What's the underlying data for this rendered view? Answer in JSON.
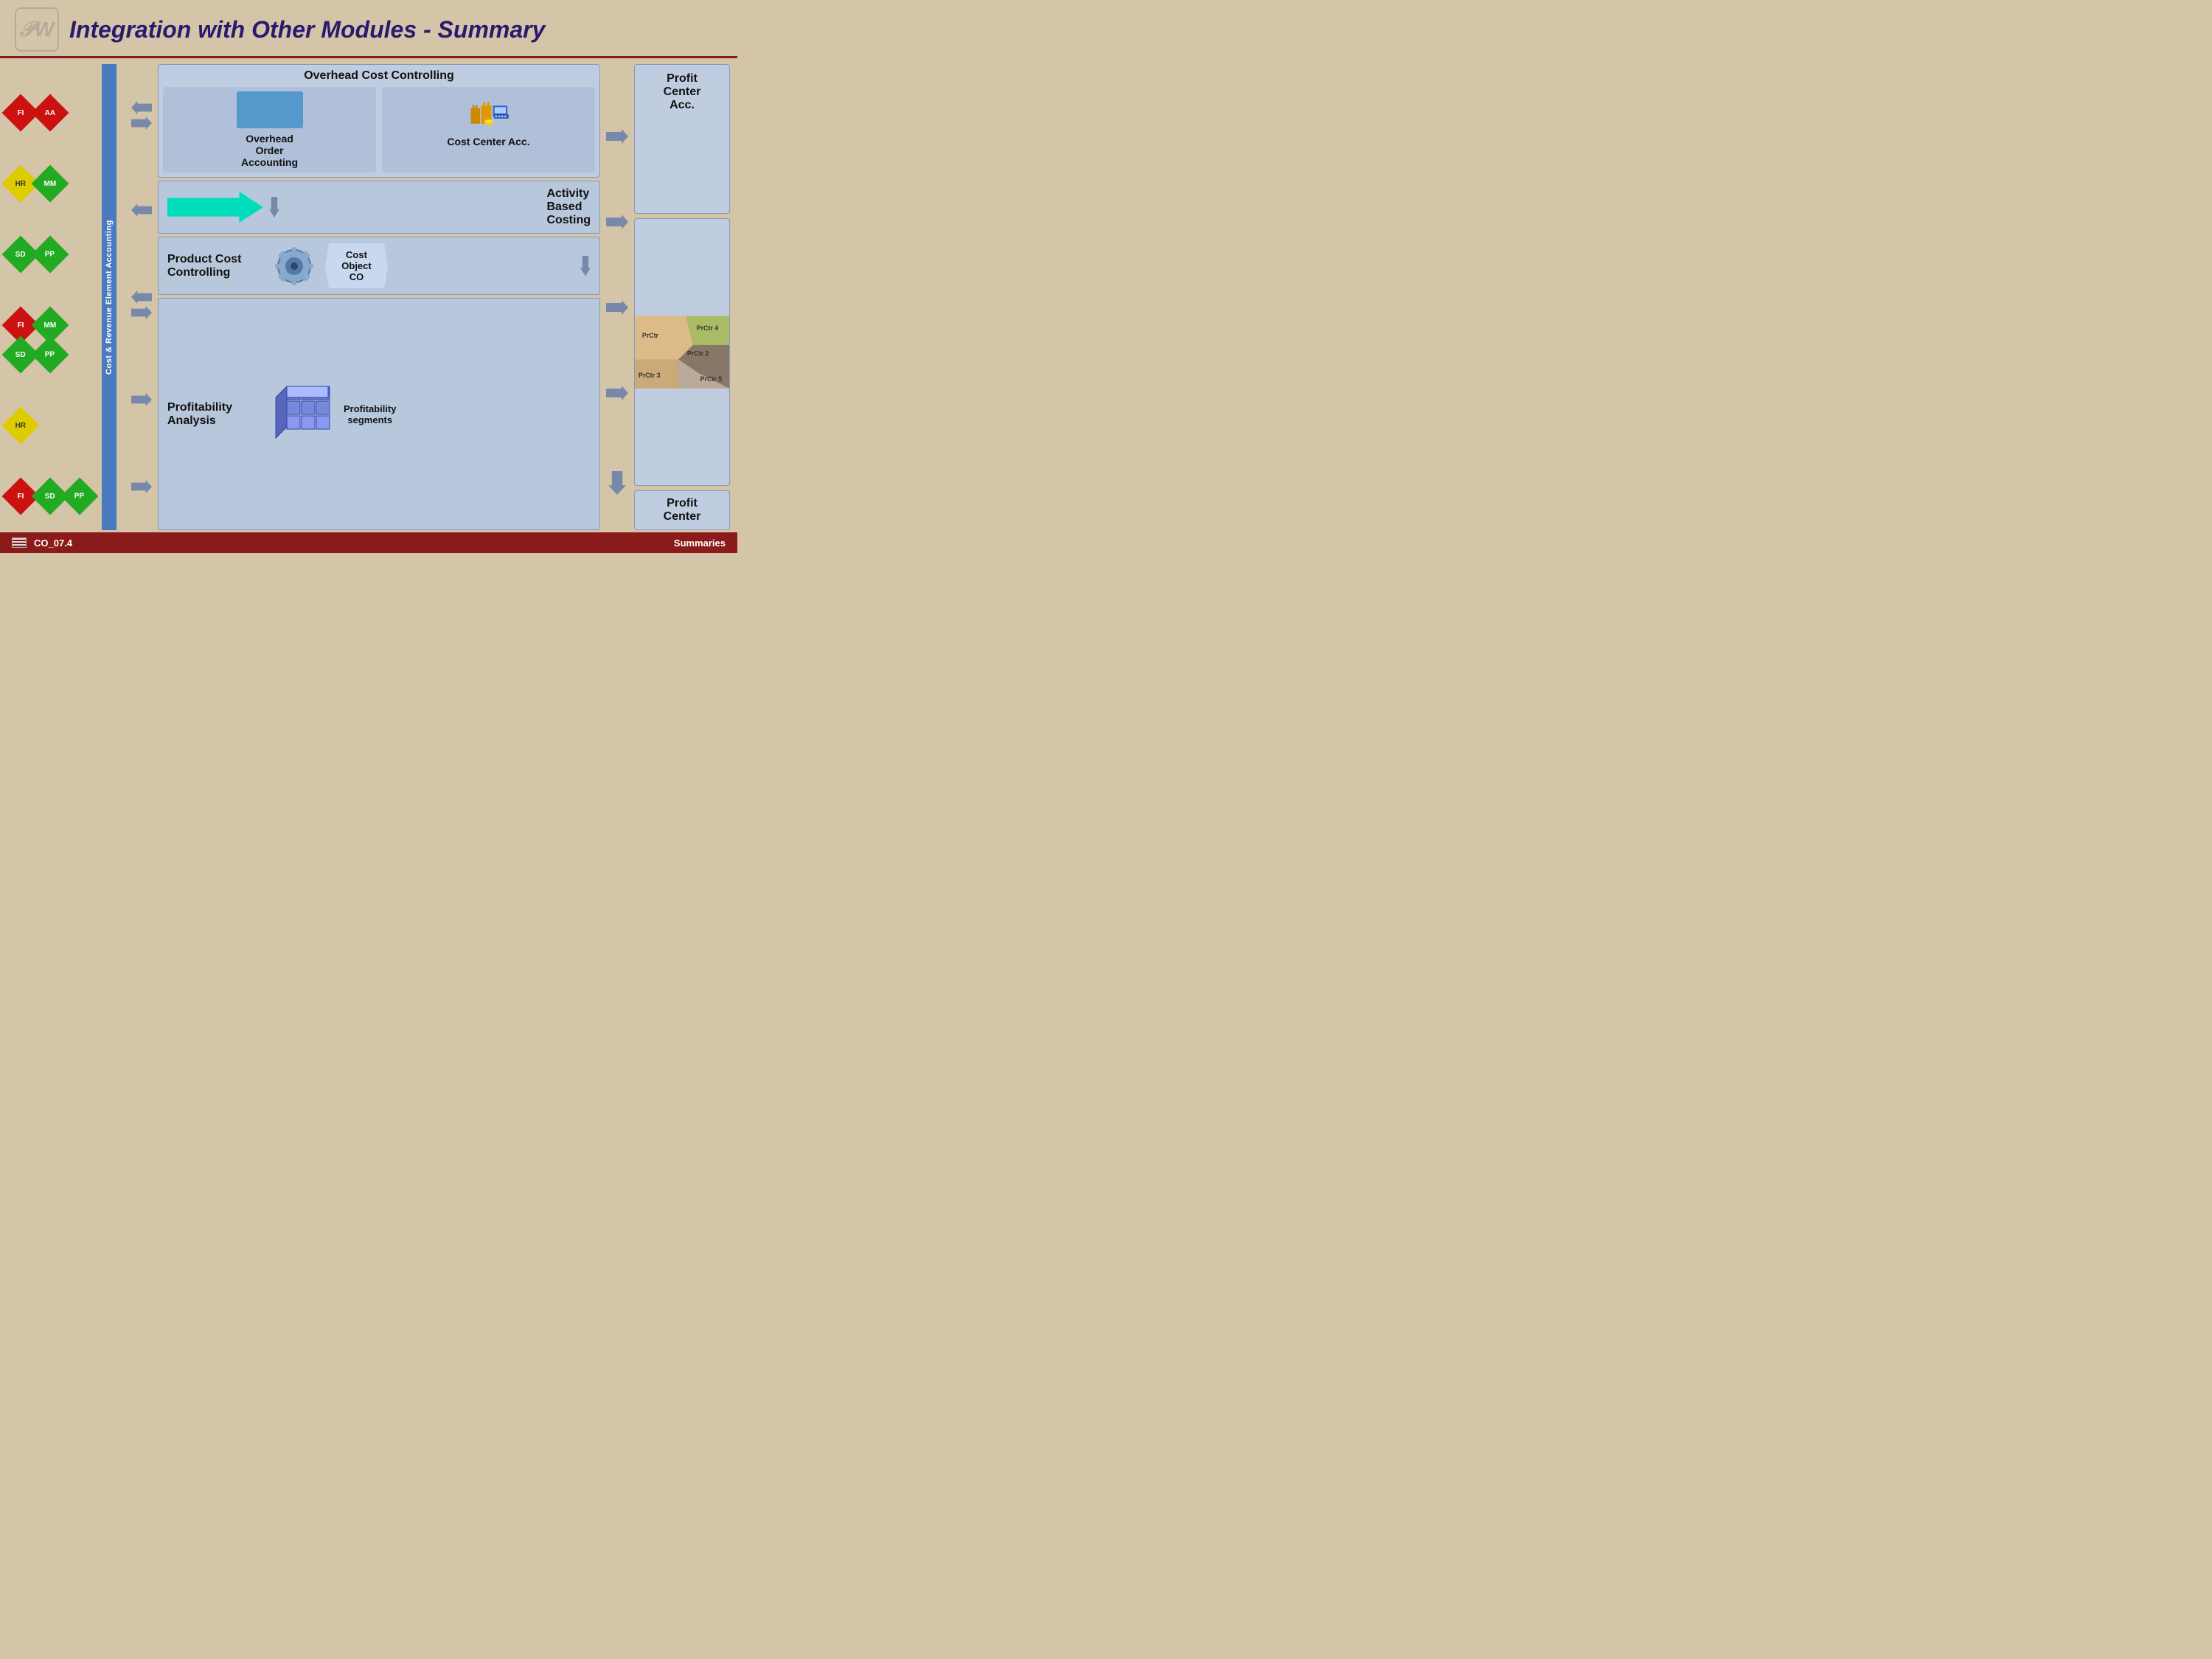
{
  "header": {
    "title": "Integration with Other Modules - Summary",
    "logo": "PW"
  },
  "left_column": {
    "vertical_label": "Cost & Revenue Element Accounting",
    "badge_groups": [
      {
        "row": [
          {
            "label": "FI",
            "color": "red"
          },
          {
            "label": "AA",
            "color": "red"
          }
        ]
      },
      {
        "row": [
          {
            "label": "HR",
            "color": "yellow"
          },
          {
            "label": "MM",
            "color": "green"
          }
        ]
      },
      {
        "row": [
          {
            "label": "SD",
            "color": "green"
          },
          {
            "label": "PP",
            "color": "green"
          }
        ]
      },
      {
        "row": [
          {
            "label": "FI",
            "color": "red"
          },
          {
            "label": "MM",
            "color": "green"
          },
          {
            "label": "SD",
            "color": "green"
          },
          {
            "label": "PP",
            "color": "green"
          }
        ]
      },
      {
        "row": [
          {
            "label": "HR",
            "color": "yellow"
          }
        ]
      },
      {
        "row": [
          {
            "label": "FI",
            "color": "red"
          },
          {
            "label": "SD",
            "color": "green"
          },
          {
            "label": "PP",
            "color": "green"
          }
        ]
      }
    ]
  },
  "diagram": {
    "occ": {
      "title": "Overhead Cost Controlling",
      "overhead_order": {
        "label": "Overhead\nOrder\nAccounting"
      },
      "cost_center": {
        "label": "Cost Center Acc."
      }
    },
    "abc": {
      "label": "Activity\nBased\nCosting"
    },
    "pcc": {
      "label": "Product Cost\nControlling",
      "co_label": "Cost\nObject\nCO"
    },
    "pa": {
      "label": "Profitability\nAnalysis",
      "seg_label": "Profitability\nsegments"
    }
  },
  "right_panel": {
    "acc_label": "Profit\nCenter\nAcc.",
    "map_labels": [
      "PrCtr",
      "PrCtr 4",
      "PrCtr 2",
      "PrCtr 3",
      "PrCtr 5"
    ],
    "bottom_label": "Profit\nCenter"
  },
  "footer": {
    "slide_id": "CO_07.4",
    "section": "Summaries"
  }
}
